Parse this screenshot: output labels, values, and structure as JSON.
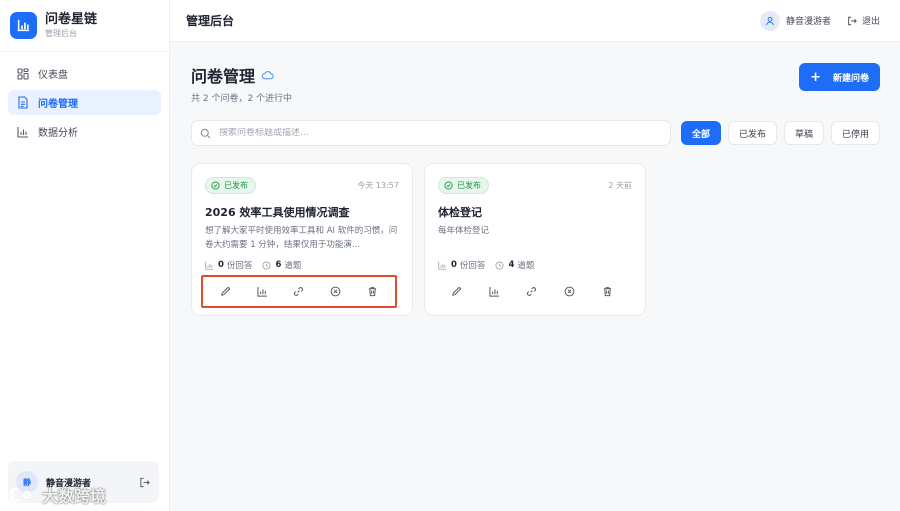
{
  "brand": {
    "title": "问卷星链",
    "subtitle": "管理后台"
  },
  "sidebar": {
    "items": [
      {
        "label": "仪表盘",
        "icon": "dashboard-icon",
        "active": false
      },
      {
        "label": "问卷管理",
        "icon": "document-icon",
        "active": true
      },
      {
        "label": "数据分析",
        "icon": "bar-chart-icon",
        "active": false
      }
    ],
    "user": {
      "avatar_text": "静",
      "name": "静音漫游者"
    }
  },
  "topbar": {
    "title": "管理后台",
    "user_name": "静音漫游者",
    "logout_label": "退出"
  },
  "page": {
    "title": "问卷管理",
    "summary": "共 2 个问卷，2 个进行中",
    "new_button_label": "新建问卷"
  },
  "search": {
    "placeholder": "搜索问卷标题或描述...",
    "value": ""
  },
  "filters": [
    "全部",
    "已发布",
    "草稿",
    "已停用"
  ],
  "active_filter": "全部",
  "surveys": [
    {
      "status": "已发布",
      "time": "今天 13:57",
      "title": "2026 效率工具使用情况调查",
      "description": "想了解大家平时使用效率工具和 AI 软件的习惯，问卷大约需要 1 分钟，结果仅用于功能演...",
      "responses_count": "0",
      "responses_label": "份回答",
      "questions_count": "6",
      "questions_label": "道题",
      "actions": [
        "edit-icon",
        "stats-icon",
        "link-icon",
        "disable-icon",
        "trash-icon"
      ],
      "highlighted": true
    },
    {
      "status": "已发布",
      "time": "2 天前",
      "title": "体检登记",
      "description": "每年体检登记",
      "responses_count": "0",
      "responses_label": "份回答",
      "questions_count": "4",
      "questions_label": "道题",
      "actions": [
        "edit-icon",
        "stats-icon",
        "link-icon",
        "disable-icon",
        "trash-icon"
      ],
      "highlighted": false
    }
  ],
  "watermark": {
    "text": "大数跨境"
  },
  "colors": {
    "accent": "#1e6df6",
    "success": "#1d9448",
    "highlight": "#e24a2c"
  }
}
